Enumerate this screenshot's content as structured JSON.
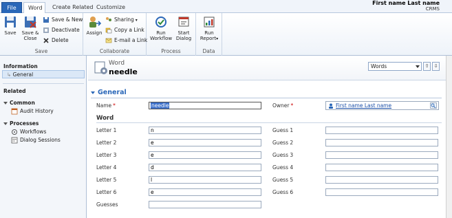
{
  "ribbon": {
    "tabs": [
      "File",
      "Word",
      "Create Related",
      "Customize"
    ],
    "user_name": "First name Last name",
    "org_name": "CRMS",
    "groups": {
      "save": {
        "label": "Save",
        "save": "Save",
        "save_close_1": "Save &",
        "save_close_2": "Close",
        "save_new": "Save & New",
        "deactivate": "Deactivate",
        "delete": "Delete"
      },
      "collaborate": {
        "label": "Collaborate",
        "assign": "Assign",
        "sharing": "Sharing",
        "copy_link": "Copy a Link",
        "email_link": "E-mail a Link"
      },
      "process": {
        "label": "Process",
        "run_workflow_1": "Run",
        "run_workflow_2": "Workflow",
        "start_dialog_1": "Start",
        "start_dialog_2": "Dialog"
      },
      "data": {
        "label": "Data",
        "run_report_1": "Run",
        "run_report_2": "Report"
      }
    }
  },
  "leftnav": {
    "information": "Information",
    "general": "General",
    "related": "Related",
    "common": "Common",
    "audit_history": "Audit History",
    "processes": "Processes",
    "workflows": "Workflows",
    "dialog_sessions": "Dialog Sessions"
  },
  "header": {
    "entity_type": "Word",
    "record_name": "needle",
    "form_selector": "Words"
  },
  "form": {
    "section_title": "General",
    "subsection_title": "Word",
    "name_label": "Name",
    "name_value": "needle",
    "owner_label": "Owner",
    "owner_value": "First name Last name",
    "letters": [
      {
        "label": "Letter 1",
        "value": "n"
      },
      {
        "label": "Letter 2",
        "value": "e"
      },
      {
        "label": "Letter 3",
        "value": "e"
      },
      {
        "label": "Letter 4",
        "value": "d"
      },
      {
        "label": "Letter 5",
        "value": "l"
      },
      {
        "label": "Letter 6",
        "value": "e"
      }
    ],
    "guesses": [
      {
        "label": "Guess 1",
        "value": ""
      },
      {
        "label": "Guess 2",
        "value": ""
      },
      {
        "label": "Guess 3",
        "value": ""
      },
      {
        "label": "Guess 4",
        "value": ""
      },
      {
        "label": "Guess 5",
        "value": ""
      },
      {
        "label": "Guess 6",
        "value": ""
      }
    ],
    "guesses_label": "Guesses",
    "guesses_value": ""
  },
  "icons": {
    "save": "floppy-disk-icon",
    "save_close": "save-close-icon",
    "save_new": "save-new-icon",
    "deactivate": "deactivate-icon",
    "delete": "delete-x-icon",
    "assign": "assign-icon",
    "sharing": "sharing-icon",
    "copy_link": "link-icon",
    "email_link": "email-icon",
    "run_workflow": "workflow-icon",
    "start_dialog": "dialog-icon",
    "run_report": "report-icon"
  },
  "colors": {
    "accent": "#2a67b8",
    "link": "#1a4fa8",
    "required": "#cc0000"
  }
}
